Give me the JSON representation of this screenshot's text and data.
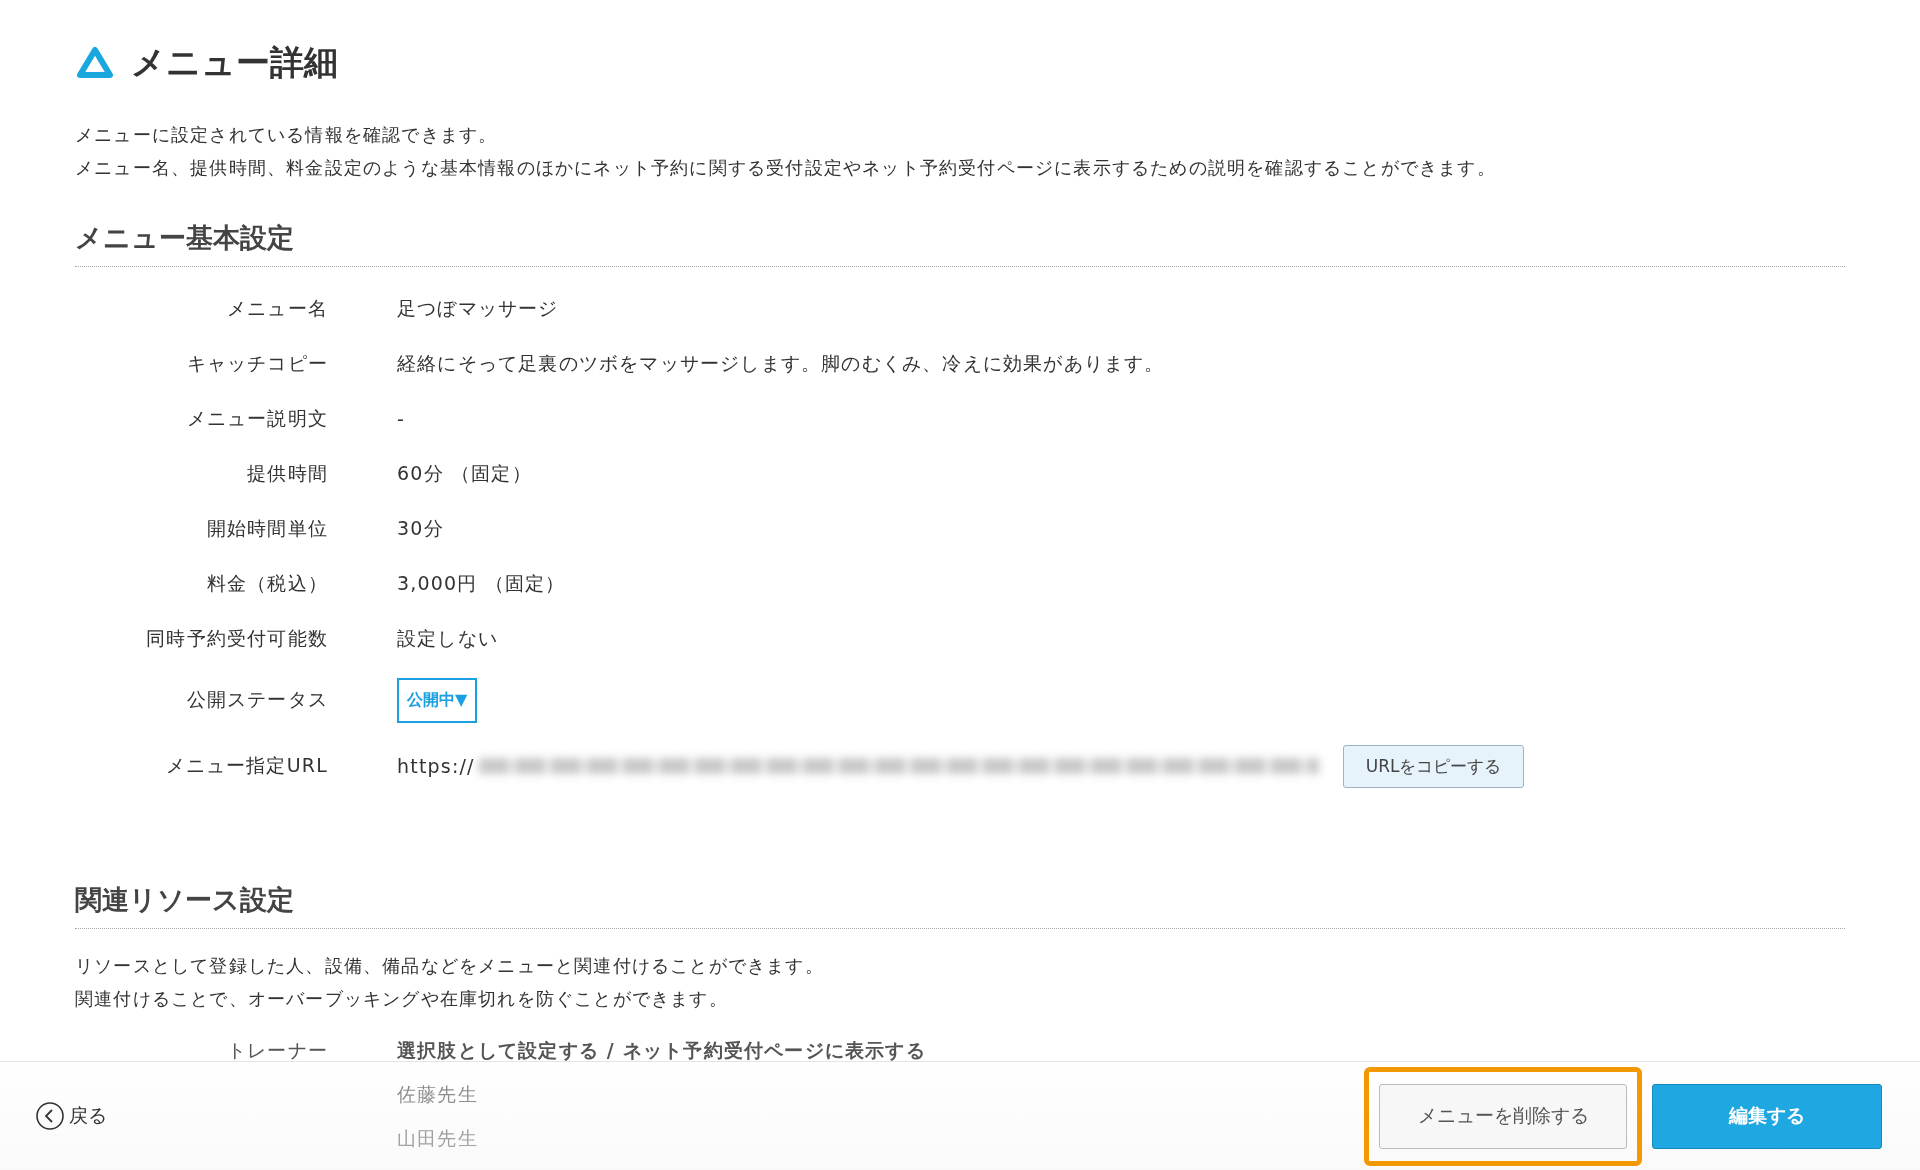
{
  "page": {
    "title": "メニュー詳細",
    "description": [
      "メニューに設定されている情報を確認できます。",
      "メニュー名、提供時間、料金設定のような基本情報のほかにネット予約に関する受付設定やネット予約受付ページに表示するための説明を確認することができます。"
    ]
  },
  "basic_settings": {
    "heading": "メニュー基本設定",
    "rows": [
      {
        "kind": "text",
        "label": "メニュー名",
        "value": "足つぼマッサージ"
      },
      {
        "kind": "text",
        "label": "キャッチコピー",
        "value": "経絡にそって足裏のツボをマッサージします。脚のむくみ、冷えに効果があります。"
      },
      {
        "kind": "text",
        "label": "メニュー説明文",
        "value": "-"
      },
      {
        "kind": "text",
        "label": "提供時間",
        "value": "60分 （固定）"
      },
      {
        "kind": "text",
        "label": "開始時間単位",
        "value": "30分"
      },
      {
        "kind": "text",
        "label": "料金（税込）",
        "value": "3,000円 （固定）"
      },
      {
        "kind": "text",
        "label": "同時予約受付可能数",
        "value": "設定しない"
      },
      {
        "kind": "dropdown",
        "label": "公開ステータス",
        "value": "公開中▼"
      },
      {
        "kind": "url",
        "label": "メニュー指定URL",
        "value": "https://",
        "button": "URLをコピーする"
      }
    ]
  },
  "resource_settings": {
    "heading": "関連リソース設定",
    "description": [
      "リソースとして登録した人、設備、備品などをメニューと関連付けることができます。",
      "関連付けることで、オーバーブッキングや在庫切れを防ぐことができます。"
    ],
    "rows": [
      {
        "label": "トレーナー",
        "value": "選択肢として設定する / ネット予約受付ページに表示する",
        "items": [
          "佐藤先生",
          "山田先生"
        ]
      }
    ]
  },
  "footer": {
    "back": "戻る",
    "delete_button": "メニューを削除する",
    "delete_highlighted": true,
    "edit_button": "編集する"
  }
}
